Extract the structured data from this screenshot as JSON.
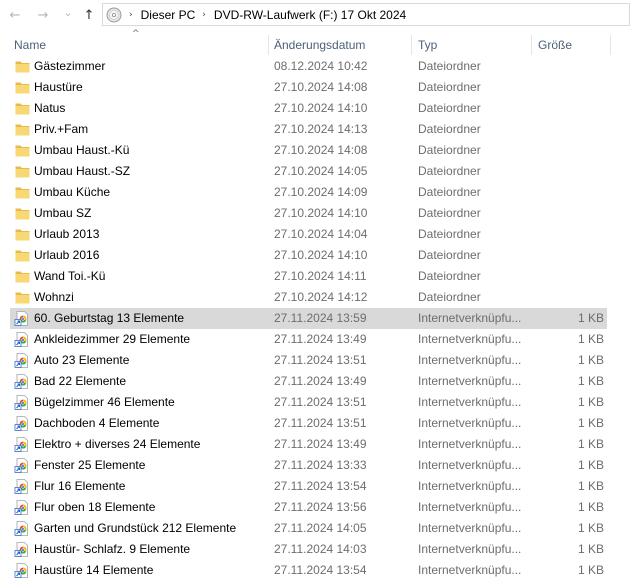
{
  "address": {
    "back_glyph": "←",
    "forward_glyph": "→",
    "recent_glyph": "⌄",
    "up_glyph": "↑",
    "sep_glyph": "›",
    "crumbs": [
      "Dieser PC",
      "DVD-RW-Laufwerk (F:) 17 Okt 2024"
    ]
  },
  "columns": {
    "name": "Name",
    "date": "Änderungsdatum",
    "type": "Typ",
    "size": "Größe",
    "sort_glyph": "^"
  },
  "colors": {
    "folder": "#f8d775",
    "selected_row": "#d9d9d9",
    "header_text": "#4c607a"
  },
  "files": [
    {
      "icon": "folder-icon",
      "name": "Gästezimmer",
      "date": "08.12.2024 10:42",
      "type": "Dateiordner",
      "size": ""
    },
    {
      "icon": "folder-icon",
      "name": "Haustüre",
      "date": "27.10.2024 14:08",
      "type": "Dateiordner",
      "size": ""
    },
    {
      "icon": "folder-icon",
      "name": "Natus",
      "date": "27.10.2024 14:10",
      "type": "Dateiordner",
      "size": ""
    },
    {
      "icon": "folder-icon",
      "name": "Priv.+Fam",
      "date": "27.10.2024 14:13",
      "type": "Dateiordner",
      "size": ""
    },
    {
      "icon": "folder-icon",
      "name": "Umbau Haust.-Kü",
      "date": "27.10.2024 14:08",
      "type": "Dateiordner",
      "size": ""
    },
    {
      "icon": "folder-icon",
      "name": "Umbau Haust.-SZ",
      "date": "27.10.2024 14:05",
      "type": "Dateiordner",
      "size": ""
    },
    {
      "icon": "folder-icon",
      "name": "Umbau Küche",
      "date": "27.10.2024 14:09",
      "type": "Dateiordner",
      "size": ""
    },
    {
      "icon": "folder-icon",
      "name": "Umbau SZ",
      "date": "27.10.2024 14:10",
      "type": "Dateiordner",
      "size": ""
    },
    {
      "icon": "folder-icon",
      "name": "Urlaub 2013",
      "date": "27.10.2024 14:04",
      "type": "Dateiordner",
      "size": ""
    },
    {
      "icon": "folder-icon",
      "name": "Urlaub 2016",
      "date": "27.10.2024 14:10",
      "type": "Dateiordner",
      "size": ""
    },
    {
      "icon": "folder-icon",
      "name": "Wand Toi.-Kü",
      "date": "27.10.2024 14:11",
      "type": "Dateiordner",
      "size": ""
    },
    {
      "icon": "folder-icon",
      "name": "Wohnzi",
      "date": "27.10.2024 14:12",
      "type": "Dateiordner",
      "size": ""
    },
    {
      "icon": "shortcut-icon",
      "name": "60. Geburtstag 13 Elemente",
      "date": "27.11.2024 13:59",
      "type": "Internetverknüpfu...",
      "size": "1 KB",
      "selected": true
    },
    {
      "icon": "shortcut-icon",
      "name": "Ankleidezimmer 29 Elemente",
      "date": "27.11.2024 13:49",
      "type": "Internetverknüpfu...",
      "size": "1 KB"
    },
    {
      "icon": "shortcut-icon",
      "name": "Auto 23 Elemente",
      "date": "27.11.2024 13:51",
      "type": "Internetverknüpfu...",
      "size": "1 KB"
    },
    {
      "icon": "shortcut-icon",
      "name": "Bad 22 Elemente",
      "date": "27.11.2024 13:49",
      "type": "Internetverknüpfu...",
      "size": "1 KB"
    },
    {
      "icon": "shortcut-icon",
      "name": "Bügelzimmer 46 Elemente",
      "date": "27.11.2024 13:51",
      "type": "Internetverknüpfu...",
      "size": "1 KB"
    },
    {
      "icon": "shortcut-icon",
      "name": "Dachboden 4 Elemente",
      "date": "27.11.2024 13:51",
      "type": "Internetverknüpfu...",
      "size": "1 KB"
    },
    {
      "icon": "shortcut-icon",
      "name": "Elektro + diverses 24 Elemente",
      "date": "27.11.2024 13:49",
      "type": "Internetverknüpfu...",
      "size": "1 KB"
    },
    {
      "icon": "shortcut-icon",
      "name": "Fenster 25 Elemente",
      "date": "27.11.2024 13:33",
      "type": "Internetverknüpfu...",
      "size": "1 KB"
    },
    {
      "icon": "shortcut-icon",
      "name": "Flur 16 Elemente",
      "date": "27.11.2024 13:54",
      "type": "Internetverknüpfu...",
      "size": "1 KB"
    },
    {
      "icon": "shortcut-icon",
      "name": "Flur oben 18 Elemente",
      "date": "27.11.2024 13:56",
      "type": "Internetverknüpfu...",
      "size": "1 KB"
    },
    {
      "icon": "shortcut-icon",
      "name": "Garten und Grundstück 212 Elemente",
      "date": "27.11.2024 14:05",
      "type": "Internetverknüpfu...",
      "size": "1 KB"
    },
    {
      "icon": "shortcut-icon",
      "name": "Haustür- Schlafz. 9 Elemente",
      "date": "27.11.2024 14:03",
      "type": "Internetverknüpfu...",
      "size": "1 KB"
    },
    {
      "icon": "shortcut-icon",
      "name": "Haustüre 14 Elemente",
      "date": "27.11.2024 13:54",
      "type": "Internetverknüpfu...",
      "size": "1 KB"
    }
  ]
}
